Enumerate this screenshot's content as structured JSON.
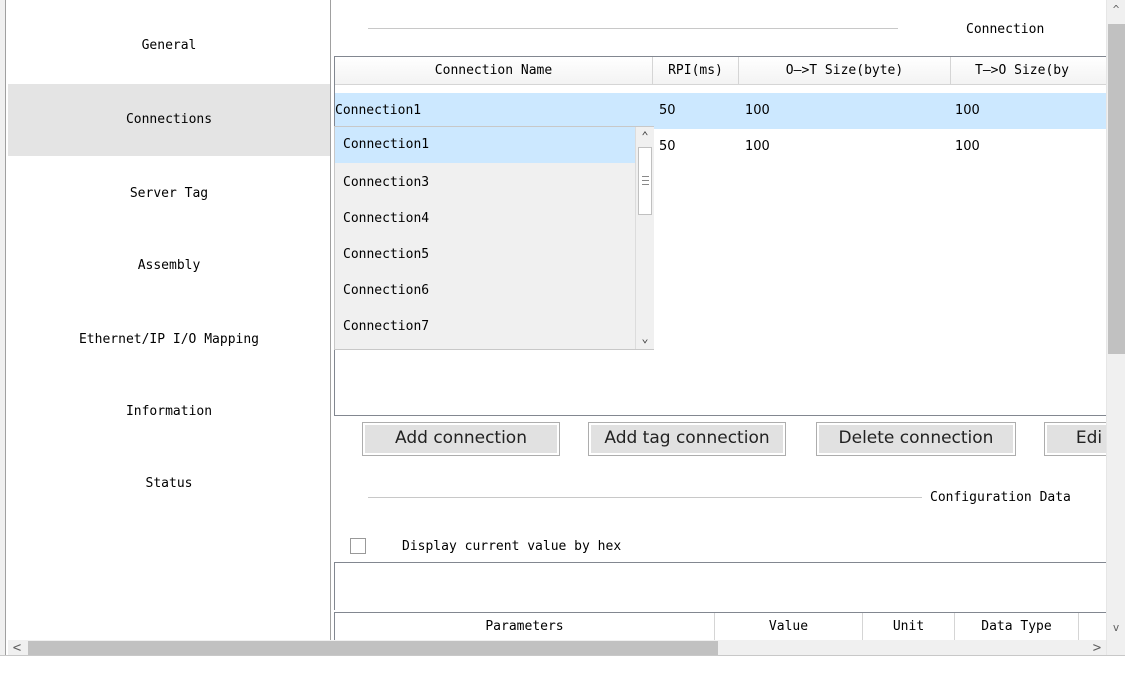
{
  "sidebar": {
    "items": [
      {
        "label": "General",
        "selected": false
      },
      {
        "label": "Connections",
        "selected": true
      },
      {
        "label": "Server Tag",
        "selected": false
      },
      {
        "label": "Assembly",
        "selected": false
      },
      {
        "label": "Ethernet/IP I/O Mapping",
        "selected": false
      },
      {
        "label": "Information",
        "selected": false
      },
      {
        "label": "Status",
        "selected": false
      }
    ]
  },
  "connection_group": {
    "title": "Connection",
    "table": {
      "columns": [
        "Connection Name",
        "RPI(ms)",
        "O—>T Size(byte)",
        "T—>O Size(by"
      ],
      "rows": [
        {
          "name": "Connection1",
          "rpi": "50",
          "ot_size": "100",
          "to_size": "100"
        },
        {
          "name": "",
          "rpi": "50",
          "ot_size": "100",
          "to_size": "100"
        }
      ]
    },
    "dropdown": {
      "items": [
        "Connection1",
        "Connection3",
        "Connection4",
        "Connection5",
        "Connection6",
        "Connection7"
      ],
      "selected": "Connection1"
    }
  },
  "buttons": {
    "add_connection": "Add connection",
    "add_tag_connection": "Add tag connection",
    "delete_connection": "Delete connection",
    "edit": "Edi"
  },
  "config_group": {
    "title": "Configuration Data",
    "hex_checkbox_label": "Display current value by hex",
    "hex_checked": false,
    "param_columns": [
      "Parameters",
      "Value",
      "Unit",
      "Data Type"
    ]
  },
  "icons": {
    "scroll_up": "^",
    "scroll_down": "v",
    "scroll_left": "<",
    "scroll_right": ">",
    "dropdown_up": "⌃",
    "dropdown_down": "⌄"
  },
  "colors": {
    "selection": "#cce8ff",
    "sidebar_selected": "#e4e4e4"
  }
}
